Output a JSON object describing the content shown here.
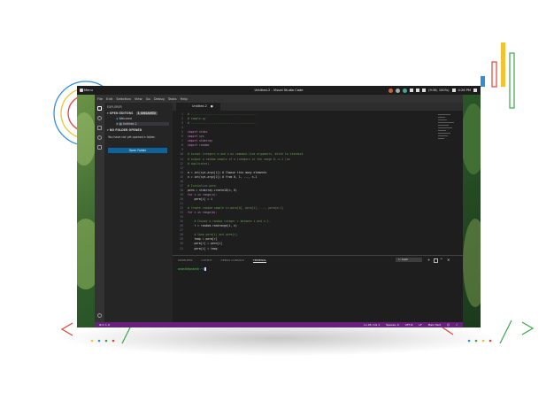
{
  "colors": {
    "accent_blue": "#2f8fd8",
    "accent_yellow": "#f2c230",
    "accent_red": "#e0443a",
    "accent_green": "#3aa64a",
    "status_bar": "#68217a",
    "open_folder_button": "#0e639c"
  },
  "panel": {
    "menu_label": "Menu",
    "window_title": "Untitled-2 - Visual Studio Code",
    "tray_text": "(9:36, 100%)",
    "clock": "4:26 PM"
  },
  "vscode": {
    "menubar": [
      "File",
      "Edit",
      "Selection",
      "View",
      "Go",
      "Debug",
      "Tasks",
      "Help"
    ],
    "activity_icons": [
      "files-icon",
      "search-icon",
      "source-control-icon",
      "debug-icon",
      "extensions-icon"
    ],
    "sidebar": {
      "title": "EXPLORER",
      "open_editors_header": "OPEN EDITORS",
      "open_editors_badge": "1 UNSAVED",
      "open_editors": [
        "Welcome",
        "Untitled-2"
      ],
      "no_folder_header": "NO FOLDER OPENED",
      "no_folder_message": "You have not yet opened a folder.",
      "open_folder_button": "Open Folder"
    },
    "editor": {
      "tab_label": "Untitled-2",
      "lines": [
        "# ----------------------------------------",
        "# sample.py",
        "# ----------------------------------------",
        "",
        "import stdio",
        "import sys",
        "import stdarray",
        "import random",
        "",
        "# Accept integers m and n as command-line arguments. Write to standard",
        "# output a random sample of m integers in the range 0..n-1 (no",
        "# duplicates).",
        "",
        "m = int(sys.argv[1]) # Choose this many elements",
        "n = int(sys.argv[2]) # from 0, 1, ..., n-1",
        "",
        "# Initialize perm.",
        "perm = stdarray.create1D(n, 0)",
        "for i in range(n):",
        "    perm[i] = i",
        "",
        "# Create random sample in perm[0], perm[1], ..., perm[m-1]",
        "for i in range(m):",
        "",
        "    # Choose a random integer r between i and n-1.",
        "    r = random.randrange(i, n)",
        "",
        "    # Swap perm[i] and perm[r].",
        "    temp = perm[r]",
        "    perm[r] = perm[i]",
        "    perm[i] = temp"
      ]
    },
    "panel": {
      "tabs": [
        "PROBLEMS",
        "OUTPUT",
        "DEBUG CONSOLE",
        "TERMINAL"
      ],
      "active_tab": "TERMINAL",
      "terminal_select": "1: bash",
      "prompt_user": "ananth@ananth",
      "prompt_path": ":~$"
    },
    "statusbar": {
      "left": "⊗ 0 ⚠ 0",
      "items": [
        "Ln 45, Col 1",
        "Spaces: 4",
        "UTF-8",
        "LF",
        "Plain Text"
      ]
    }
  }
}
